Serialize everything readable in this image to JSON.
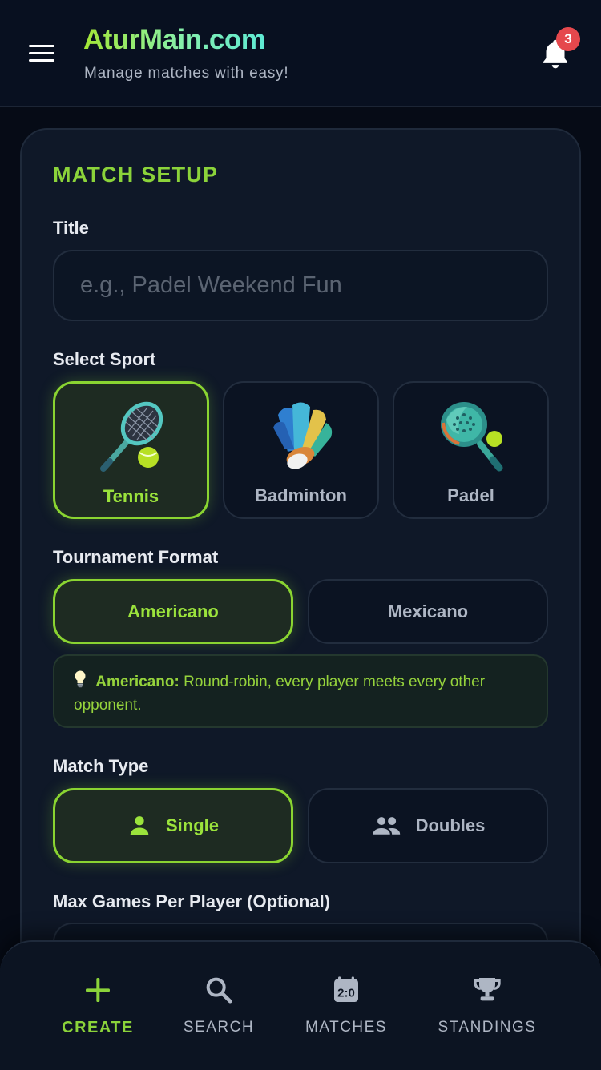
{
  "header": {
    "brand_title": "AturMain.com",
    "brand_subtitle": "Manage matches with easy!",
    "notification_count": "3"
  },
  "form": {
    "section_title": "MATCH SETUP",
    "title_label": "Title",
    "title_placeholder": "e.g., Padel Weekend Fun",
    "title_value": "",
    "sport_label": "Select Sport",
    "sports": [
      {
        "label": "Tennis",
        "icon": "tennis-racket-icon",
        "selected": true
      },
      {
        "label": "Badminton",
        "icon": "shuttlecock-icon",
        "selected": false
      },
      {
        "label": "Padel",
        "icon": "padel-racket-icon",
        "selected": false
      }
    ],
    "format_label": "Tournament Format",
    "formats": [
      {
        "label": "Americano",
        "selected": true
      },
      {
        "label": "Mexicano",
        "selected": false
      }
    ],
    "format_info": {
      "icon": "lightbulb-icon",
      "term": "Americano:",
      "description": "Round-robin, every player meets every other opponent."
    },
    "match_type_label": "Match Type",
    "match_types": [
      {
        "label": "Single",
        "icon": "person-icon",
        "selected": true
      },
      {
        "label": "Doubles",
        "icon": "people-icon",
        "selected": false
      }
    ],
    "max_games_label": "Max Games Per Player (Optional)"
  },
  "nav": {
    "items": [
      {
        "label": "CREATE",
        "icon": "plus-icon",
        "active": true
      },
      {
        "label": "SEARCH",
        "icon": "search-icon",
        "active": false
      },
      {
        "label": "MATCHES",
        "icon": "scoreboard-icon",
        "active": false
      },
      {
        "label": "STANDINGS",
        "icon": "trophy-icon",
        "active": false
      }
    ]
  },
  "colors": {
    "accent": "#8bd33a",
    "background": "#060b16",
    "card": "#0f1828",
    "badge": "#e5484d"
  }
}
